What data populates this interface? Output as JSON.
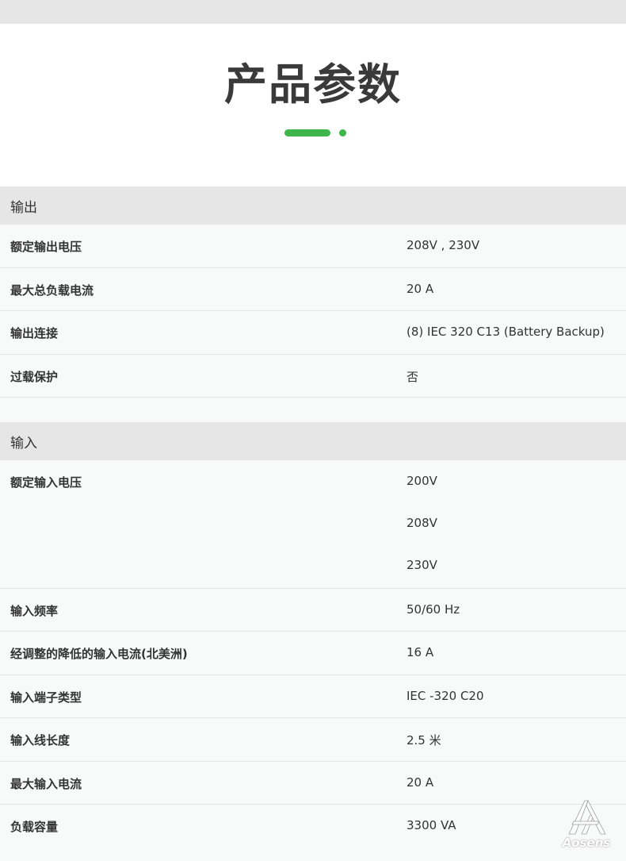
{
  "header": {
    "title": "产品参数"
  },
  "accent_color": "#3cb64a",
  "sections": {
    "output": {
      "title": "输出",
      "rows": [
        {
          "label": "额定输出电压",
          "value": "208V , 230V"
        },
        {
          "label": "最大总负载电流",
          "value": "20 A"
        },
        {
          "label": "输出连接",
          "value": "(8) IEC 320 C13 (Battery Backup)"
        },
        {
          "label": "过载保护",
          "value": "否"
        }
      ]
    },
    "input": {
      "title": "输入",
      "voltage_row": {
        "label": "额定输入电压",
        "values": [
          "200V",
          "208V",
          "230V"
        ]
      },
      "rows": [
        {
          "label": "输入频率",
          "value": "50/60 Hz"
        },
        {
          "label": "经调整的降低的输入电流(北美洲)",
          "value": "16 A"
        },
        {
          "label": "输入端子类型",
          "value": "IEC -320 C20"
        },
        {
          "label": "输入线长度",
          "value": "2.5 米"
        },
        {
          "label": "最大输入电流",
          "value": "20 A"
        },
        {
          "label": "负载容量",
          "value": "3300 VA"
        }
      ]
    }
  },
  "watermark": {
    "text": "Aosens",
    "icon": "aosens-logo-icon"
  }
}
